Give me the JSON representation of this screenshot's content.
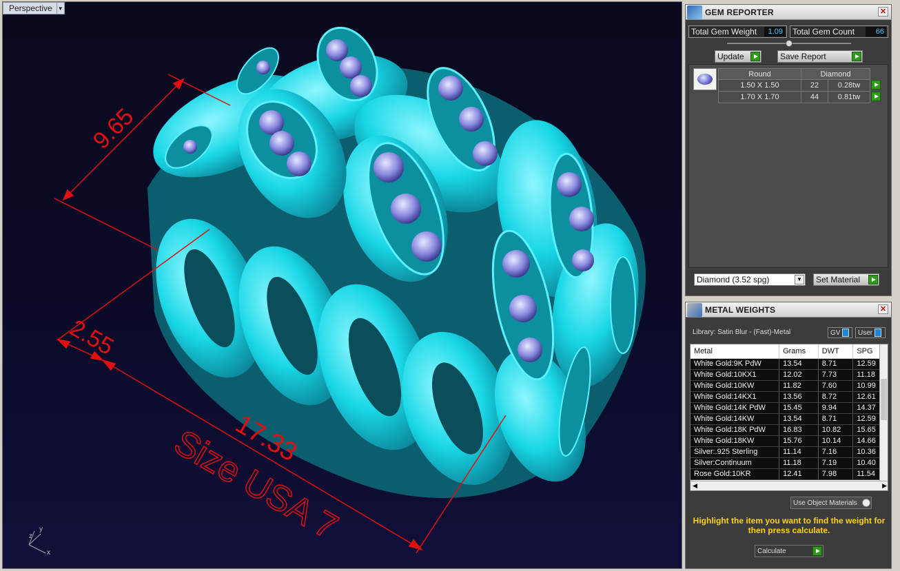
{
  "viewport": {
    "label": "Perspective",
    "axis_labels": {
      "z": "z",
      "y": "y",
      "x": "x"
    }
  },
  "dimensions": {
    "top": "9.65",
    "side": "2.55",
    "bottom": "17.33",
    "size": "Size USA 7"
  },
  "gem_reporter": {
    "title": "GEM REPORTER",
    "total_weight_label": "Total Gem Weight",
    "total_weight": "1.09",
    "total_count_label": "Total Gem Count",
    "total_count": "66",
    "update_label": "Update",
    "save_report_label": "Save Report",
    "table": {
      "headers": [
        "Round",
        "",
        "Diamond"
      ],
      "rows": [
        {
          "size": "1.50 X 1.50",
          "count": "22",
          "weight": "0.28tw"
        },
        {
          "size": "1.70 X 1.70",
          "count": "44",
          "weight": "0.81tw"
        }
      ]
    },
    "material_select": "Diamond    (3.52 spg)",
    "set_material_label": "Set Material"
  },
  "metal_weights": {
    "title": "METAL WEIGHTS",
    "library": "Library: Satin Blur - (Fast)-Metal",
    "gv_label": "GV",
    "user_label": "User",
    "columns": [
      "Metal",
      "Grams",
      "DWT",
      "SPG"
    ],
    "rows": [
      [
        "White Gold:9K PdW",
        "13.54",
        "8.71",
        "12.59"
      ],
      [
        "White Gold:10KX1",
        "12.02",
        "7.73",
        "11.18"
      ],
      [
        "White Gold:10KW",
        "11.82",
        "7.60",
        "10.99"
      ],
      [
        "White Gold:14KX1",
        "13.56",
        "8.72",
        "12.61"
      ],
      [
        "White Gold:14K PdW",
        "15.45",
        "9.94",
        "14.37"
      ],
      [
        "White Gold:14KW",
        "13.54",
        "8.71",
        "12.59"
      ],
      [
        "White Gold:18K PdW",
        "16.83",
        "10.82",
        "15.65"
      ],
      [
        "White Gold:18KW",
        "15.76",
        "10.14",
        "14.66"
      ],
      [
        "Silver:.925 Sterling",
        "11.14",
        "7.16",
        "10.36"
      ],
      [
        "Silver:Continuum",
        "11.18",
        "7.19",
        "10.40"
      ],
      [
        "Rose Gold:10KR",
        "12.41",
        "7.98",
        "11.54"
      ]
    ],
    "use_object_materials": "Use Object Materials",
    "hint": "Highlight the item you want to find the weight for then press calculate.",
    "calculate_label": "Calculate"
  },
  "colors": {
    "ring": "#19d7e6",
    "dimension": "#e01010",
    "hint": "#ffd21a",
    "viewport_bg": "#0b0b2a"
  }
}
